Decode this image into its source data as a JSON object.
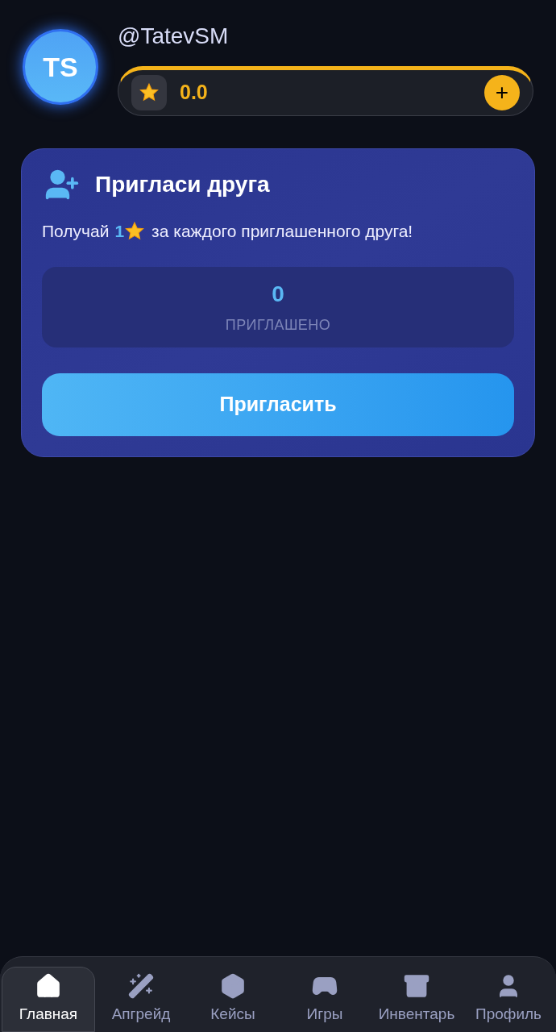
{
  "profile": {
    "initials": "TS",
    "username": "@TatevSM"
  },
  "balance": {
    "value": "0.0",
    "add_button": "+"
  },
  "invite_card": {
    "title": "Пригласи друга",
    "reward_prefix": "Получай",
    "reward_amount": "1",
    "reward_suffix": "за каждого приглашенного друга!",
    "count": "0",
    "count_label": "ПРИГЛАШЕНО",
    "button": "Пригласить"
  },
  "nav": [
    {
      "kind": "home",
      "label": "Главная",
      "selected": true
    },
    {
      "kind": "upgrade",
      "label": "Апгрейд",
      "selected": false
    },
    {
      "kind": "cases",
      "label": "Кейсы",
      "selected": false
    },
    {
      "kind": "games",
      "label": "Игры",
      "selected": false
    },
    {
      "kind": "inventory",
      "label": "Инвентарь",
      "selected": false
    },
    {
      "kind": "profile",
      "label": "Профиль",
      "selected": false
    }
  ]
}
